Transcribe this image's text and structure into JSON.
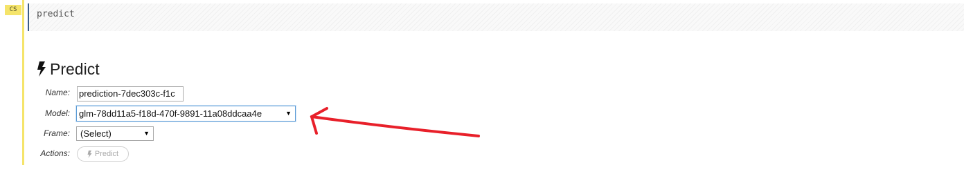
{
  "cell": {
    "type_badge": "CS",
    "code": "predict"
  },
  "output": {
    "title": "Predict",
    "title_icon": "bolt-icon",
    "fields": {
      "name_label": "Name:",
      "name_value": "prediction-7dec303c-f1c",
      "model_label": "Model:",
      "model_value": "glm-78dd11a5-f18d-470f-9891-11a08ddcaa4e",
      "frame_label": "Frame:",
      "frame_value": "(Select)",
      "actions_label": "Actions:"
    },
    "action_button": {
      "label": "Predict",
      "icon": "bolt-icon"
    }
  },
  "annotation": {
    "type": "arrow",
    "color": "#e8202a",
    "points_to": "model-select"
  }
}
